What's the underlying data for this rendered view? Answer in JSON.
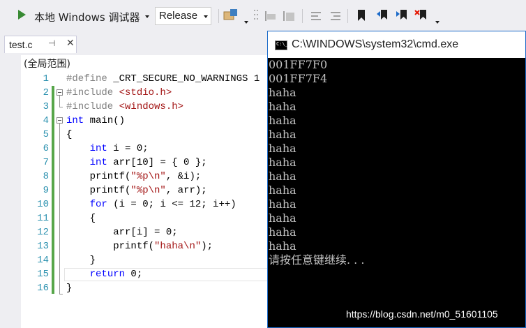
{
  "toolbar": {
    "run_label": "本地 Windows 调试器",
    "config_value": "Release"
  },
  "editor": {
    "tab_name": "test.c",
    "scope": "(全局范围)",
    "line_numbers": [
      "1",
      "2",
      "3",
      "4",
      "5",
      "6",
      "7",
      "8",
      "9",
      "10",
      "11",
      "12",
      "13",
      "14",
      "15",
      "16"
    ]
  },
  "console": {
    "title": "C:\\WINDOWS\\system32\\cmd.exe",
    "lines": [
      "001FF7F0",
      "001FF7F4",
      "haha",
      "haha",
      "haha",
      "haha",
      "haha",
      "haha",
      "haha",
      "haha",
      "haha",
      "haha",
      "haha",
      "haha",
      "请按任意键继续. . ."
    ]
  },
  "watermark": "https://blog.csdn.net/m0_51601105",
  "colors": {
    "keyword": "#0000ff",
    "preprocessor": "#808080",
    "string": "#a31515",
    "line_number": "#2b91af",
    "change_marker": "#57a64a",
    "console_text": "#c0c0c0"
  }
}
